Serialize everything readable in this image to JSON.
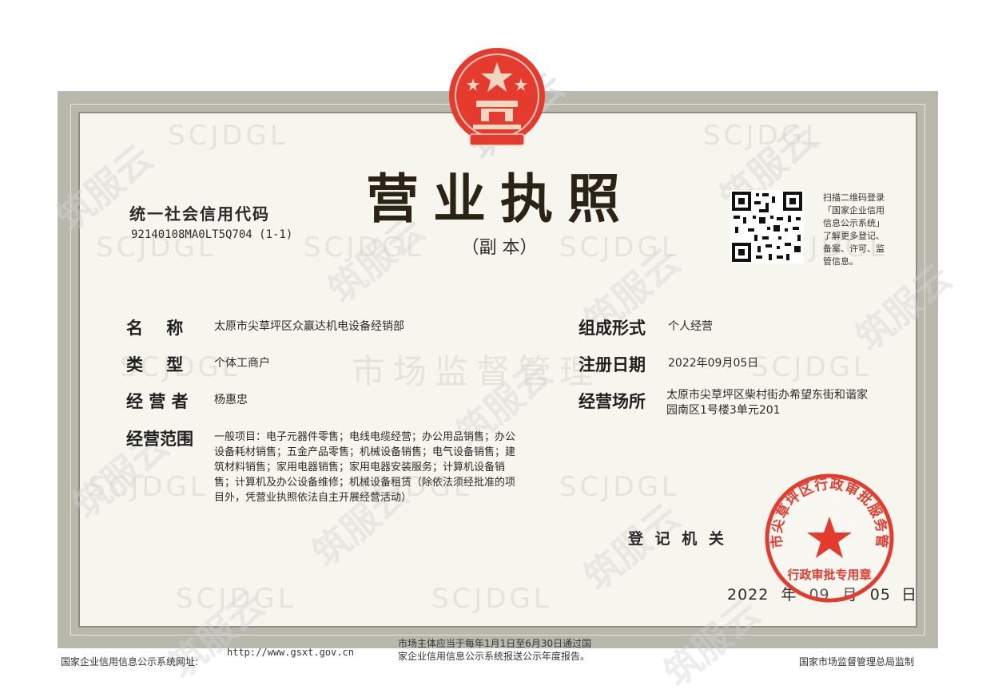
{
  "title": "营业执照",
  "subtitle": "（副 本）",
  "credit": {
    "label": "统一社会信用代码",
    "value": "92140108MA0LT5Q704 (1-1)"
  },
  "qr": {
    "caption": [
      "扫描二维码登录",
      "「国家企业信用",
      "信息公示系统」",
      "了解更多登记、",
      "备案、许可、监",
      "管信息。"
    ]
  },
  "fields": {
    "name": {
      "label": "名    称",
      "value": "太原市尖草坪区众赢达机电设备经销部"
    },
    "type": {
      "label": "类    型",
      "value": "个体工商户"
    },
    "operator": {
      "label": "经 营 者",
      "value": "杨惠忠"
    },
    "scope": {
      "label": "经营范围",
      "lines": [
        "一般项目：电子元器件零售；电线电缆经营；办公用品销售；办公",
        "设备耗材销售；五金产品零售；机械设备销售；电气设备销售；建",
        "筑材料销售；家用电器销售；家用电器安装服务；计算机设备销",
        "售；计算机及办公设备维修；机械设备租赁（除依法须经批准的项",
        "目外，凭营业执照依法自主开展经营活动）"
      ]
    },
    "form": {
      "label": "组成形式",
      "value": "个人经营"
    },
    "reg_date": {
      "label": "注册日期",
      "value": "2022年09月05日"
    },
    "place": {
      "label": "经营场所",
      "lines": [
        "太原市尖草坪区柴村街办希望东街和谐家",
        "园南区1号楼3单元201"
      ]
    }
  },
  "authority": {
    "label": "登 记 机 关"
  },
  "issue_date": {
    "year": "2022",
    "y": "年",
    "month": "09",
    "m": "月",
    "day": "05",
    "d": "日"
  },
  "seal": {
    "ring_text": "太原市尖草坪区行政审批服务管理局",
    "bottom_text": "行政审批专用章"
  },
  "footer": {
    "left": "国家企业信用信息公示系统网址:",
    "url": "http://www.gsxt.gov.cn",
    "center": [
      "市场主体应当于每年1月1日至6月30日通过国",
      "家企业信用信息公示系统报送公示年度报告。"
    ],
    "right": "国家市场监督管理总局监制"
  },
  "watermarks": {
    "latin": "SCJDGL",
    "cn": "市场监督管理",
    "brand": "筑服云"
  },
  "colors": {
    "seal_red": "#e53b2f",
    "frame": "#b9b8ad",
    "paper": "#f7f6ee"
  }
}
